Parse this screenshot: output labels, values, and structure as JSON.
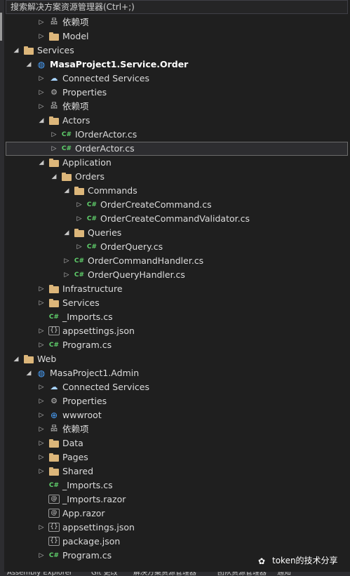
{
  "search": {
    "placeholder": "搜索解决方案资源管理器(Ctrl+;)"
  },
  "tree": [
    {
      "depth": 3,
      "expander": "collapsed",
      "icon": "dependencies-icon",
      "label": "依赖项"
    },
    {
      "depth": 3,
      "expander": "collapsed",
      "icon": "folder-icon",
      "label": "Model"
    },
    {
      "depth": 1,
      "expander": "expanded",
      "icon": "folder-icon",
      "label": "Services"
    },
    {
      "depth": 2,
      "expander": "expanded",
      "icon": "web-project-icon",
      "label": "MasaProject1.Service.Order",
      "bold": true
    },
    {
      "depth": 3,
      "expander": "collapsed",
      "icon": "connected-services-icon",
      "label": "Connected Services"
    },
    {
      "depth": 3,
      "expander": "collapsed",
      "icon": "properties-icon",
      "label": "Properties"
    },
    {
      "depth": 3,
      "expander": "collapsed",
      "icon": "dependencies-icon",
      "label": "依赖项"
    },
    {
      "depth": 3,
      "expander": "expanded",
      "icon": "folder-icon",
      "label": "Actors"
    },
    {
      "depth": 4,
      "expander": "collapsed",
      "icon": "csharp-file-icon",
      "label": "IOrderActor.cs"
    },
    {
      "depth": 4,
      "expander": "collapsed",
      "icon": "csharp-file-icon",
      "label": "OrderActor.cs",
      "selected": true
    },
    {
      "depth": 3,
      "expander": "expanded",
      "icon": "folder-icon",
      "label": "Application"
    },
    {
      "depth": 4,
      "expander": "expanded",
      "icon": "folder-icon",
      "label": "Orders"
    },
    {
      "depth": 5,
      "expander": "expanded",
      "icon": "folder-icon",
      "label": "Commands"
    },
    {
      "depth": 6,
      "expander": "collapsed",
      "icon": "csharp-file-icon",
      "label": "OrderCreateCommand.cs"
    },
    {
      "depth": 6,
      "expander": "collapsed",
      "icon": "csharp-file-icon",
      "label": "OrderCreateCommandValidator.cs"
    },
    {
      "depth": 5,
      "expander": "expanded",
      "icon": "folder-icon",
      "label": "Queries"
    },
    {
      "depth": 6,
      "expander": "collapsed",
      "icon": "csharp-file-icon",
      "label": "OrderQuery.cs"
    },
    {
      "depth": 5,
      "expander": "collapsed",
      "icon": "csharp-file-icon",
      "label": "OrderCommandHandler.cs"
    },
    {
      "depth": 5,
      "expander": "collapsed",
      "icon": "csharp-file-icon",
      "label": "OrderQueryHandler.cs"
    },
    {
      "depth": 3,
      "expander": "collapsed",
      "icon": "folder-icon",
      "label": "Infrastructure"
    },
    {
      "depth": 3,
      "expander": "collapsed",
      "icon": "folder-icon",
      "label": "Services"
    },
    {
      "depth": 3,
      "expander": "none",
      "icon": "csharp-file-icon",
      "label": "_Imports.cs"
    },
    {
      "depth": 3,
      "expander": "collapsed",
      "icon": "json-file-icon",
      "label": "appsettings.json"
    },
    {
      "depth": 3,
      "expander": "collapsed",
      "icon": "csharp-file-icon",
      "label": "Program.cs"
    },
    {
      "depth": 1,
      "expander": "expanded",
      "icon": "folder-icon",
      "label": "Web"
    },
    {
      "depth": 2,
      "expander": "expanded",
      "icon": "web-project-icon",
      "label": "MasaProject1.Admin"
    },
    {
      "depth": 3,
      "expander": "collapsed",
      "icon": "connected-services-icon",
      "label": "Connected Services"
    },
    {
      "depth": 3,
      "expander": "collapsed",
      "icon": "properties-icon",
      "label": "Properties"
    },
    {
      "depth": 3,
      "expander": "collapsed",
      "icon": "globe-icon",
      "label": "wwwroot"
    },
    {
      "depth": 3,
      "expander": "collapsed",
      "icon": "dependencies-icon",
      "label": "依赖项"
    },
    {
      "depth": 3,
      "expander": "collapsed",
      "icon": "folder-icon",
      "label": "Data"
    },
    {
      "depth": 3,
      "expander": "collapsed",
      "icon": "folder-icon",
      "label": "Pages"
    },
    {
      "depth": 3,
      "expander": "collapsed",
      "icon": "folder-icon",
      "label": "Shared"
    },
    {
      "depth": 3,
      "expander": "none",
      "icon": "csharp-file-icon",
      "label": "_Imports.cs"
    },
    {
      "depth": 3,
      "expander": "none",
      "icon": "razor-file-icon",
      "label": "_Imports.razor"
    },
    {
      "depth": 3,
      "expander": "none",
      "icon": "razor-file-icon",
      "label": "App.razor"
    },
    {
      "depth": 3,
      "expander": "collapsed",
      "icon": "json-file-icon",
      "label": "appsettings.json"
    },
    {
      "depth": 3,
      "expander": "none",
      "icon": "json-file-icon",
      "label": "package.json"
    },
    {
      "depth": 3,
      "expander": "collapsed",
      "icon": "csharp-file-icon",
      "label": "Program.cs"
    }
  ],
  "bottom_tabs": [
    "Assembly Explorer",
    "Git 更改",
    "解决方案资源管理器",
    "团队资源管理器",
    "通知"
  ],
  "watermark": {
    "text": "token的技术分享",
    "icon": "wechat-icon"
  },
  "colors": {
    "background": "#1f1f1f",
    "folder": "#dcb67a",
    "csharp": "#5fcf6b",
    "project": "#4aa3ff"
  }
}
